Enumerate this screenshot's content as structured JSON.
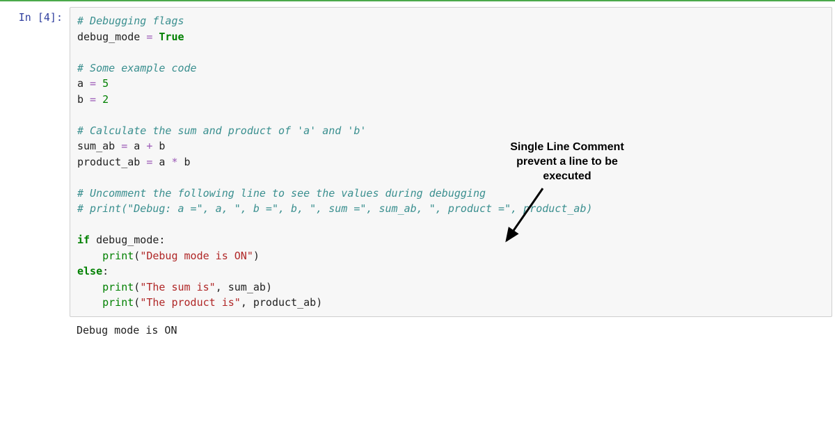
{
  "cell": {
    "prompt": "In [4]:",
    "code": {
      "l1_comment": "# Debugging flags",
      "l2_var": "debug_mode",
      "l2_eq": " = ",
      "l2_val": "True",
      "l3_comment": "# Some example code",
      "l4_var": "a",
      "l4_eq": " = ",
      "l4_val": "5",
      "l5_var": "b",
      "l5_eq": " = ",
      "l5_val": "2",
      "l6_comment": "# Calculate the sum and product of 'a' and 'b'",
      "l7_var": "sum_ab",
      "l7_eq": " = ",
      "l7_a": "a",
      "l7_plus": " + ",
      "l7_b": "b",
      "l8_var": "product_ab",
      "l8_eq": " = ",
      "l8_a": "a",
      "l8_star": " * ",
      "l8_b": "b",
      "l9_comment": "# Uncomment the following line to see the values during debugging",
      "l10_comment": "# print(\"Debug: a =\", a, \", b =\", b, \", sum =\", sum_ab, \", product =\", product_ab)",
      "l11_if": "if",
      "l11_sp1": " ",
      "l11_var": "debug_mode",
      "l11_colon": ":",
      "l12_indent": "    ",
      "l12_print": "print",
      "l12_lparen": "(",
      "l12_str": "\"Debug mode is ON\"",
      "l12_rparen": ")",
      "l13_else": "else",
      "l13_colon": ":",
      "l14_indent": "    ",
      "l14_print": "print",
      "l14_lparen": "(",
      "l14_str": "\"The sum is\"",
      "l14_comma": ", ",
      "l14_var": "sum_ab",
      "l14_rparen": ")",
      "l15_indent": "    ",
      "l15_print": "print",
      "l15_lparen": "(",
      "l15_str": "\"The product is\"",
      "l15_comma": ", ",
      "l15_var": "product_ab",
      "l15_rparen": ")"
    },
    "output": "Debug mode is ON"
  },
  "annotation": {
    "line1": "Single Line Comment",
    "line2": "prevent a line to be",
    "line3": "executed"
  }
}
